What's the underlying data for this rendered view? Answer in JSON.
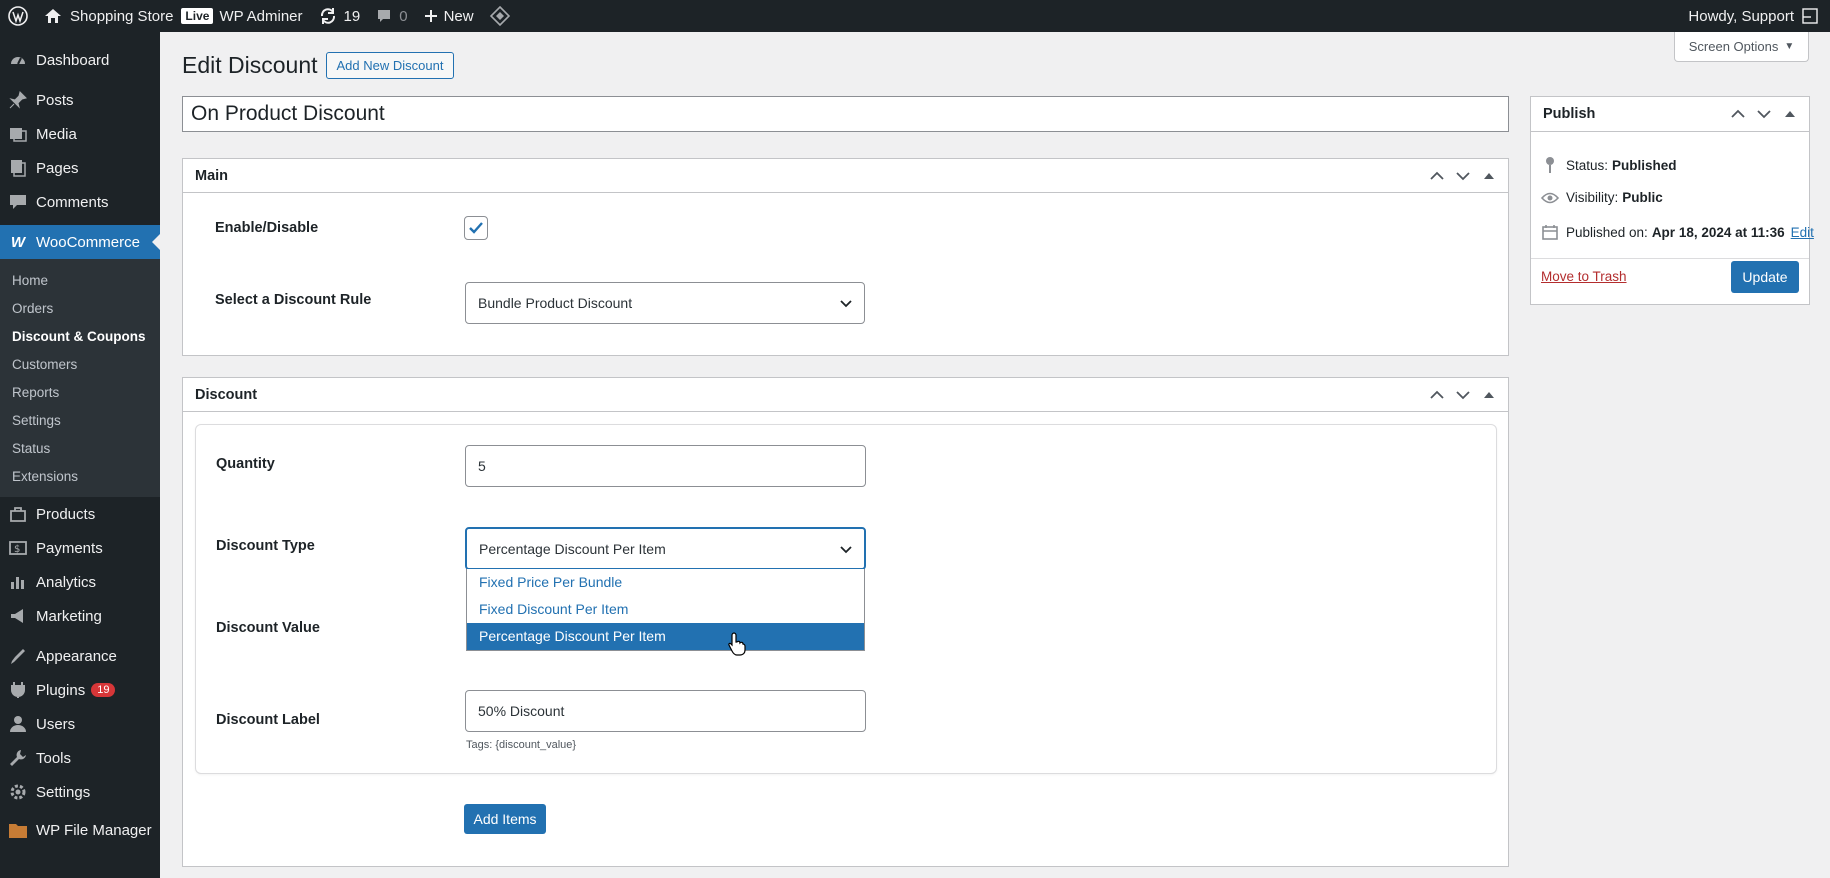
{
  "adminbar": {
    "site_name": "Shopping Store",
    "live_badge": "Live",
    "admin_label": "WP Adminer",
    "updates_count": "19",
    "comments_count": "0",
    "new_label": "New",
    "greeting": "Howdy, Support"
  },
  "sidebar": {
    "items": [
      {
        "label": "Dashboard",
        "icon": "dashboard-icon"
      },
      {
        "label": "Posts",
        "icon": "pin-icon"
      },
      {
        "label": "Media",
        "icon": "media-icon"
      },
      {
        "label": "Pages",
        "icon": "pages-icon"
      },
      {
        "label": "Comments",
        "icon": "comment-icon"
      },
      {
        "label": "WooCommerce",
        "icon": "woo-icon"
      }
    ],
    "woo_submenu": [
      "Home",
      "Orders",
      "Discount & Coupons",
      "Customers",
      "Reports",
      "Settings",
      "Status",
      "Extensions"
    ],
    "lower_items": [
      {
        "label": "Products",
        "icon": "products-icon"
      },
      {
        "label": "Payments",
        "icon": "payments-icon"
      },
      {
        "label": "Analytics",
        "icon": "analytics-icon"
      },
      {
        "label": "Marketing",
        "icon": "marketing-icon"
      },
      {
        "label": "Appearance",
        "icon": "appearance-icon"
      },
      {
        "label": "Plugins",
        "icon": "plugins-icon",
        "badge": "19"
      },
      {
        "label": "Users",
        "icon": "users-icon"
      },
      {
        "label": "Tools",
        "icon": "tools-icon"
      },
      {
        "label": "Settings",
        "icon": "settings-icon"
      },
      {
        "label": "WP File Manager",
        "icon": "file-manager-icon"
      }
    ]
  },
  "page": {
    "title": "Edit Discount",
    "add_new_label": "Add New Discount",
    "screen_options": "Screen Options",
    "post_title": "On Product Discount"
  },
  "main_box": {
    "title": "Main",
    "enable_label": "Enable/Disable",
    "enable_checked": true,
    "rule_label": "Select a Discount Rule",
    "rule_value": "Bundle Product Discount"
  },
  "discount_box": {
    "title": "Discount",
    "quantity_label": "Quantity",
    "quantity_value": "5",
    "type_label": "Discount Type",
    "type_value": "Percentage Discount Per Item",
    "type_options": [
      "Fixed Price Per Bundle",
      "Fixed Discount Per Item",
      "Percentage Discount Per Item"
    ],
    "value_label": "Discount Value",
    "label_label": "Discount Label",
    "label_value": "50% Discount",
    "tags_note": "Tags: {discount_value}",
    "add_items": "Add Items"
  },
  "publish": {
    "title": "Publish",
    "status_label": "Status:",
    "status_value": "Published",
    "visibility_label": "Visibility:",
    "visibility_value": "Public",
    "published_label": "Published on:",
    "published_value": "Apr 18, 2024 at 11:36",
    "edit_link": "Edit",
    "trash_link": "Move to Trash",
    "update_button": "Update"
  },
  "colors": {
    "accent": "#2271b1",
    "sidebar_bg": "#1d2327",
    "danger": "#d63638"
  }
}
